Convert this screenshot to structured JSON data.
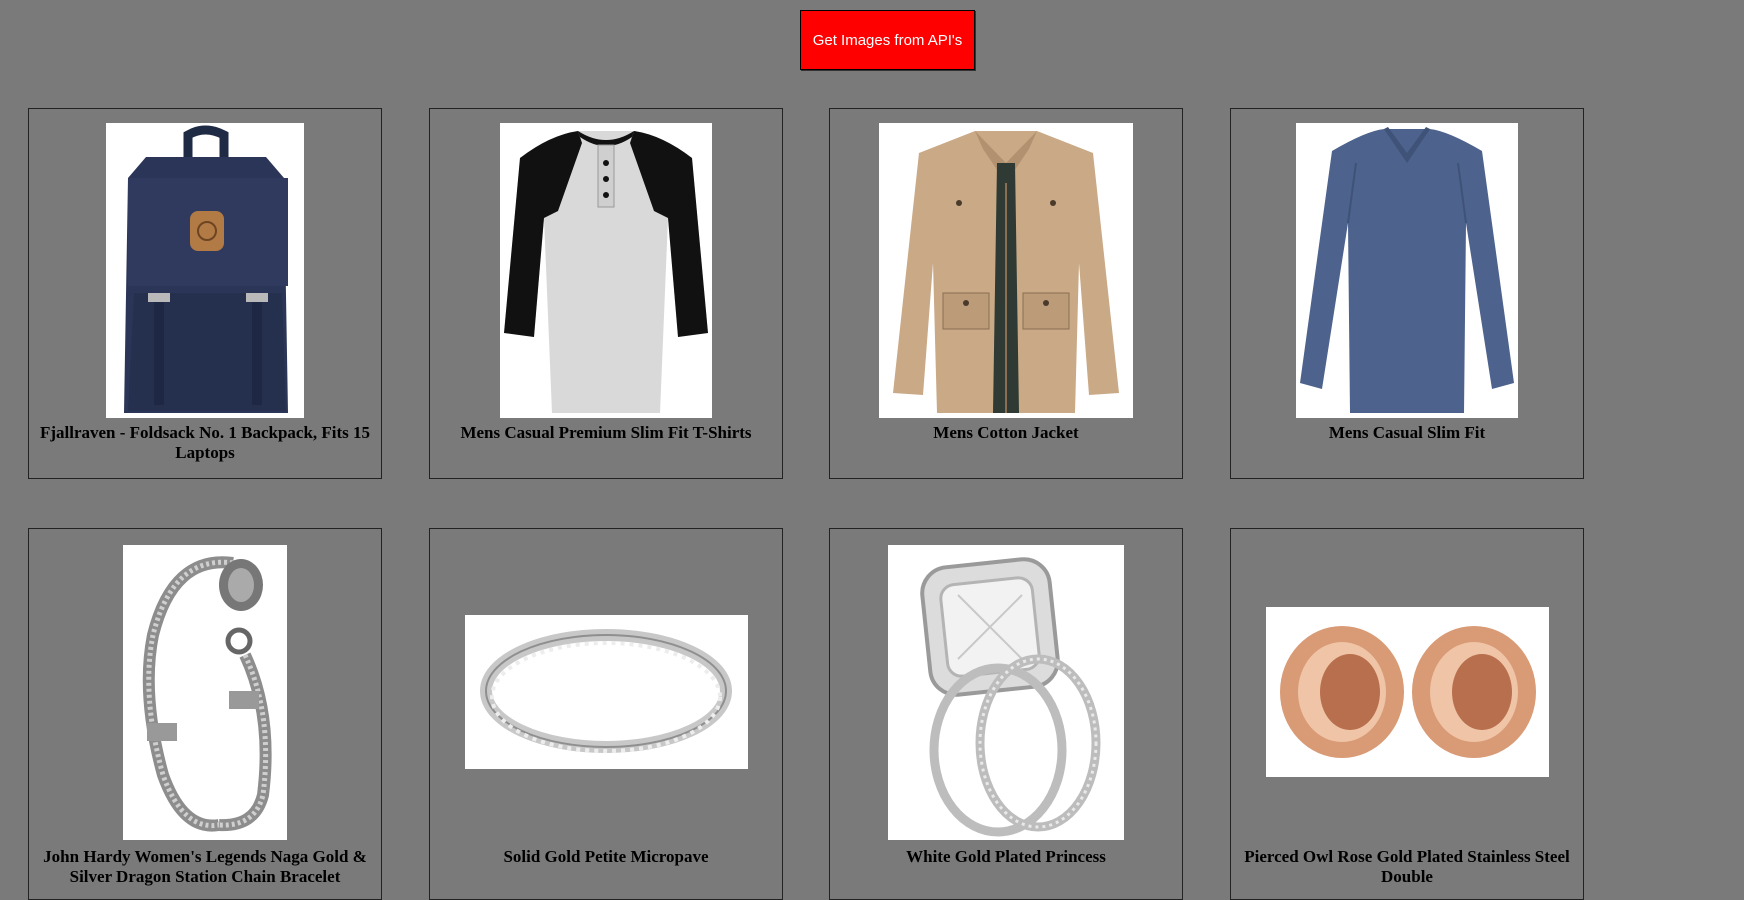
{
  "header": {
    "button_label": "Get Images from API's"
  },
  "products": [
    {
      "title": "Fjallraven - Foldsack No. 1 Backpack, Fits 15 Laptops",
      "image_icon": "backpack"
    },
    {
      "title": "Mens Casual Premium Slim Fit T-Shirts",
      "image_icon": "raglan-shirt"
    },
    {
      "title": "Mens Cotton Jacket",
      "image_icon": "jacket"
    },
    {
      "title": "Mens Casual Slim Fit",
      "image_icon": "long-sleeve-shirt"
    },
    {
      "title": "John Hardy Women's Legends Naga Gold & Silver Dragon Station Chain Bracelet",
      "image_icon": "bracelet"
    },
    {
      "title": "Solid Gold Petite Micropave",
      "image_icon": "ring"
    },
    {
      "title": "White Gold Plated Princess",
      "image_icon": "princess-ring-set"
    },
    {
      "title": "Pierced Owl Rose Gold Plated Stainless Steel Double",
      "image_icon": "rose-gold-plugs"
    }
  ],
  "colors": {
    "page_background": "#7a7a7a",
    "button_background": "#ff0000",
    "button_text": "#ffffff"
  }
}
